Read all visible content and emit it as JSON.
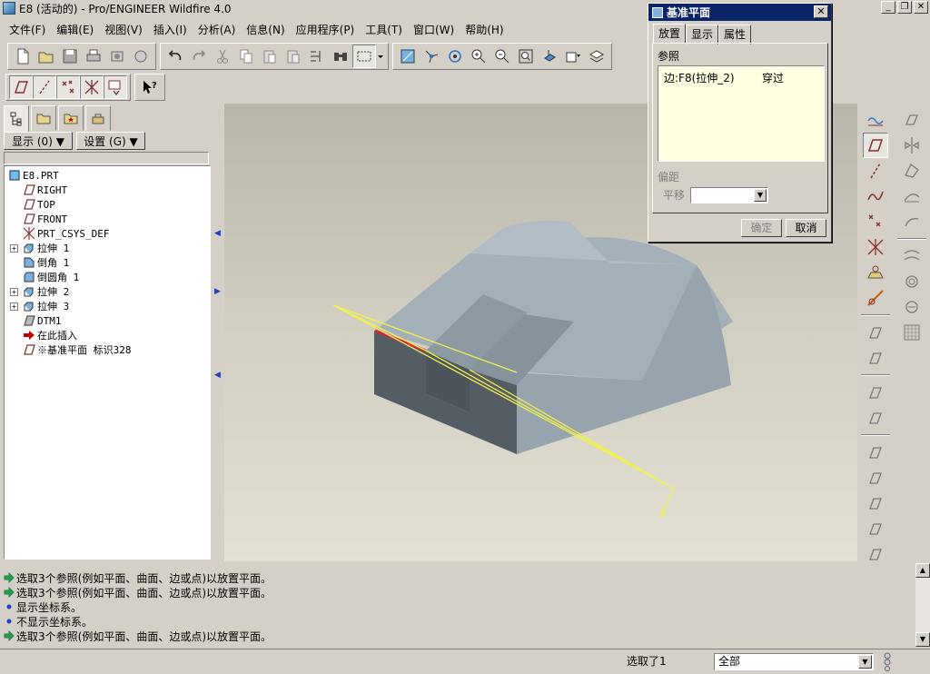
{
  "window": {
    "title": "E8 (活动的) - Pro/ENGINEER Wildfire 4.0",
    "controls": [
      "_",
      "❐",
      "✕"
    ]
  },
  "menubar": [
    "文件(F)",
    "编辑(E)",
    "视图(V)",
    "插入(I)",
    "分析(A)",
    "信息(N)",
    "应用程序(P)",
    "工具(T)",
    "窗口(W)",
    "帮助(H)"
  ],
  "toolbar": {
    "main_icons": [
      "new-icon",
      "open-icon",
      "save-icon",
      "print-icon",
      "send-icon",
      "email-icon",
      "undo-icon",
      "redo-icon",
      "cut-icon",
      "copy-icon",
      "paste-icon",
      "paste-special-icon",
      "regenerate-icon",
      "find-icon",
      "select-box-icon",
      "repaint-icon",
      "spin-center-icon",
      "orient-icon",
      "zoom-in-icon",
      "zoom-out-icon",
      "refit-icon",
      "view-orient-icon",
      "saved-views-icon",
      "layers-icon"
    ],
    "datum_icons": [
      "datum-plane-toggle-icon",
      "datum-axis-toggle-icon",
      "datum-point-toggle-icon",
      "csys-toggle-icon",
      "annotation-toggle-icon",
      "context-help-icon"
    ]
  },
  "left_panel": {
    "tabs": [
      "model-tree-tab",
      "folder-browser-tab",
      "favorites-tab",
      "connections-tab"
    ],
    "show_button": "显示 (0) ▼",
    "settings_button": "设置 (G) ▼",
    "tree": [
      {
        "label": "E8.PRT",
        "icon": "part-icon",
        "indent": 0,
        "expander": ""
      },
      {
        "label": "RIGHT",
        "icon": "datum-plane-icon",
        "indent": 1,
        "expander": ""
      },
      {
        "label": "TOP",
        "icon": "datum-plane-icon",
        "indent": 1,
        "expander": ""
      },
      {
        "label": "FRONT",
        "icon": "datum-plane-icon",
        "indent": 1,
        "expander": ""
      },
      {
        "label": "PRT_CSYS_DEF",
        "icon": "csys-icon",
        "indent": 1,
        "expander": ""
      },
      {
        "label": "拉伸 1",
        "icon": "extrude-icon",
        "indent": 1,
        "expander": "+"
      },
      {
        "label": "倒角 1",
        "icon": "chamfer-icon",
        "indent": 1,
        "expander": ""
      },
      {
        "label": "倒圆角 1",
        "icon": "round-icon",
        "indent": 1,
        "expander": ""
      },
      {
        "label": "拉伸 2",
        "icon": "extrude-icon",
        "indent": 1,
        "expander": "+"
      },
      {
        "label": "拉伸 3",
        "icon": "extrude-icon",
        "indent": 1,
        "expander": "+"
      },
      {
        "label": "DTM1",
        "icon": "datum-plane-gray-icon",
        "indent": 1,
        "expander": ""
      },
      {
        "label": "在此插入",
        "icon": "insert-here-arrow-icon",
        "indent": 1,
        "expander": ""
      },
      {
        "label": "※基准平面 标识328",
        "icon": "datum-plane-icon",
        "indent": 1,
        "expander": ""
      }
    ]
  },
  "messages": [
    {
      "icon": "prompt-arrow-icon",
      "text": "选取3个参照(例如平面、曲面、边或点)以放置平面。"
    },
    {
      "icon": "prompt-arrow-icon",
      "text": "选取3个参照(例如平面、曲面、边或点)以放置平面。"
    },
    {
      "icon": "info-dot-icon",
      "text": "显示坐标系。"
    },
    {
      "icon": "info-dot-icon",
      "text": "不显示坐标系。"
    },
    {
      "icon": "prompt-arrow-icon",
      "text": "选取3个参照(例如平面、曲面、边或点)以放置平面。"
    }
  ],
  "statusbar": {
    "selected": "选取了1",
    "filter": "全部"
  },
  "dialog": {
    "title": "基准平面",
    "close": "✕",
    "tabs": [
      "放置",
      "显示",
      "属性"
    ],
    "refs_label": "参照",
    "references": [
      {
        "ref": "边:F8(拉伸_2)",
        "constraint": "穿过"
      }
    ],
    "offset_label": "偏距",
    "translate_label": "平移",
    "translate_value": "",
    "ok": "确定",
    "cancel": "取消"
  },
  "right_toolbar": {
    "col1": [
      "sketched-curve-icon",
      "datum-plane-icon",
      "datum-axis-icon",
      "datum-curve-icon",
      "datum-point-icon",
      "csys-icon",
      "analysis-feature-icon",
      "sketcher-icon",
      "extrude-icon",
      "revolve-icon",
      "variable-sweep-icon",
      "blend-icon",
      "hole-icon",
      "shell-icon",
      "rib-icon",
      "draft-icon",
      "round-icon",
      "chamfer-icon"
    ],
    "col2": [
      "copy-feature-icon",
      "mirror-icon",
      "merge-icon",
      "trim-icon",
      "extend-icon",
      "offset-icon",
      "thicken-icon",
      "solidify-icon",
      "pattern-icon"
    ]
  },
  "colors": {
    "titlebar_active": "#0a246a",
    "model_face": "#9aa7b0",
    "model_dark_face": "#525a62",
    "highlight_edge": "#e0203a",
    "preview_plane": "#f0f050",
    "ref_box_bg": "#ffffe1"
  }
}
